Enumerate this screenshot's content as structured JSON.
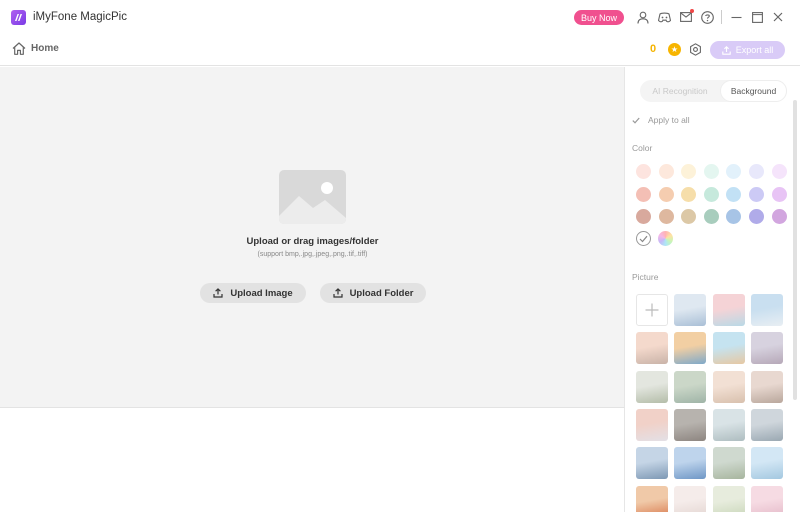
{
  "app": {
    "title": "iMyFone MagicPic"
  },
  "titlebar": {
    "buy_now": "Buy Now",
    "icons": [
      "account-icon",
      "discord-icon",
      "mail-icon",
      "help-icon",
      "minimize-icon",
      "maximize-icon",
      "close-icon"
    ]
  },
  "nav": {
    "home_label": "Home",
    "credits": "0",
    "export_label": "Export all"
  },
  "workspace": {
    "upload_title": "Upload or drag images/folder",
    "upload_sub": "(support bmp,.jpg,.jpeg,.png,.tif,.tiff)",
    "upload_image_label": "Upload Image",
    "upload_folder_label": "Upload Folder"
  },
  "panel": {
    "tabs": [
      {
        "label": "AI Recognition",
        "active": false
      },
      {
        "label": "Background",
        "active": true
      }
    ],
    "apply_all_label": "Apply to all",
    "color_label": "Color",
    "picture_label": "Picture",
    "colors": [
      "#fde4df",
      "#fde8dc",
      "#fdf2d9",
      "#e4f6f0",
      "#e2f1fb",
      "#e8e8fb",
      "#f5e4fb",
      "#f4bfb5",
      "#f5cdb0",
      "#f6deaa",
      "#c6e9dc",
      "#c2e1f5",
      "#cccaf5",
      "#e8c4f5",
      "#d8a99d",
      "#deb89f",
      "#dcc8a6",
      "#a8cdbd",
      "#a7c4e6",
      "#b0abe9",
      "#d2a6df"
    ]
  },
  "theme": {
    "accent": "#f0508f",
    "brand": "#8a45ea",
    "export_disabled": "#d9cbf7",
    "coin": "#f7b500"
  }
}
